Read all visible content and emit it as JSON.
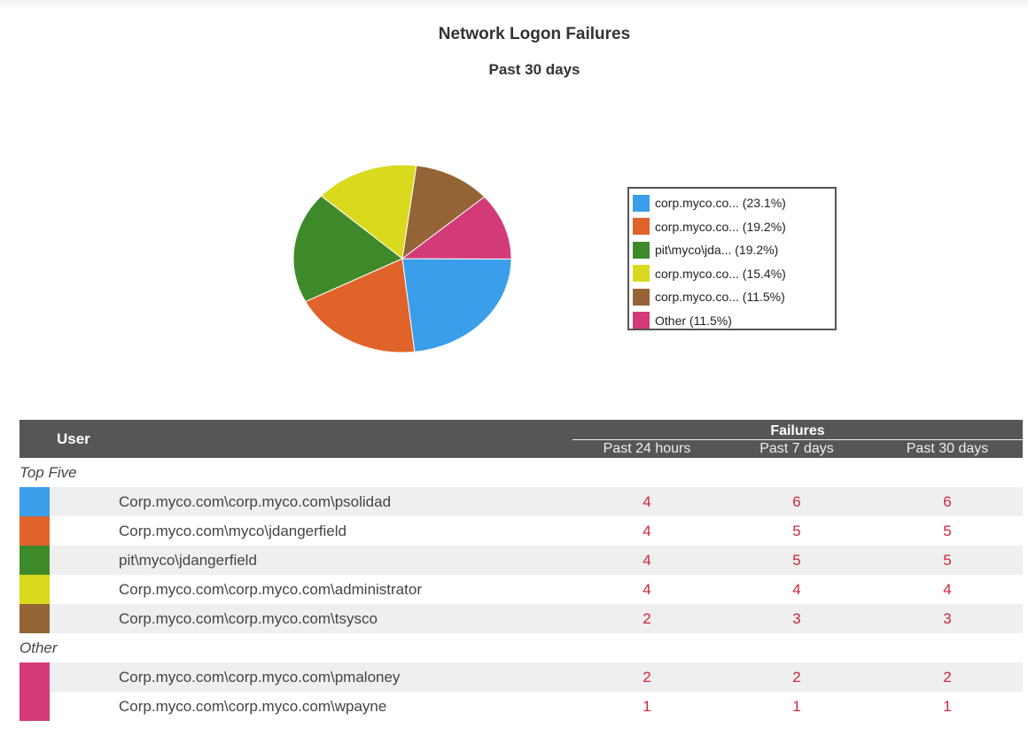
{
  "chart_data": {
    "type": "pie",
    "title": "Network Logon Failures",
    "subtitle": "Past 30 days",
    "slices": [
      {
        "label": "corp.myco.co... (23.1%)",
        "value": 23.1,
        "color": "#3a9eea"
      },
      {
        "label": "corp.myco.co... (19.2%)",
        "value": 19.2,
        "color": "#e0632a"
      },
      {
        "label": "pit\\myco\\jda... (19.2%)",
        "value": 19.2,
        "color": "#3e8a2a"
      },
      {
        "label": "corp.myco.co... (15.4%)",
        "value": 15.4,
        "color": "#d9d91e"
      },
      {
        "label": "corp.myco.co... (11.5%)",
        "value": 11.5,
        "color": "#946437"
      },
      {
        "label": "Other (11.5%)",
        "value": 11.5,
        "color": "#d33a78"
      }
    ],
    "legend_position": "right"
  },
  "table": {
    "user_header": "User",
    "failures_header": "Failures",
    "columns": [
      "Past 24 hours",
      "Past 7 days",
      "Past 30 days"
    ],
    "groups": [
      {
        "label": "Top Five",
        "rows": [
          {
            "color": "#3a9eea",
            "user": "Corp.myco.com\\corp.myco.com\\psolidad",
            "values": [
              "4",
              "6",
              "6"
            ]
          },
          {
            "color": "#e0632a",
            "user": "Corp.myco.com\\myco\\jdangerfield",
            "values": [
              "4",
              "5",
              "5"
            ]
          },
          {
            "color": "#3e8a2a",
            "user": "pit\\myco\\jdangerfield",
            "values": [
              "4",
              "5",
              "5"
            ]
          },
          {
            "color": "#d9d91e",
            "user": "Corp.myco.com\\corp.myco.com\\administrator",
            "values": [
              "4",
              "4",
              "4"
            ]
          },
          {
            "color": "#946437",
            "user": "Corp.myco.com\\corp.myco.com\\tsysco",
            "values": [
              "2",
              "3",
              "3"
            ]
          }
        ]
      },
      {
        "label": "Other",
        "rows": [
          {
            "color": "#d33a78",
            "user": "Corp.myco.com\\corp.myco.com\\pmaloney",
            "values": [
              "2",
              "2",
              "2"
            ]
          },
          {
            "color": "#d33a78",
            "user": "Corp.myco.com\\corp.myco.com\\wpayne",
            "values": [
              "1",
              "1",
              "1"
            ]
          }
        ]
      }
    ]
  }
}
